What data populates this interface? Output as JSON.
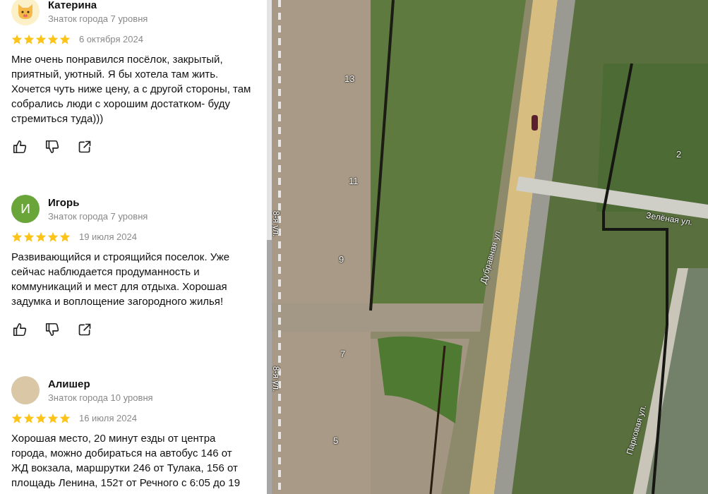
{
  "reviews": [
    {
      "author": "Катерина",
      "badge": "Знаток города 7 уровня",
      "avatar": {
        "kind": "emoji"
      },
      "stars": 5,
      "date": "6 октября 2024",
      "text": "Мне очень понравился посёлок, закрытый, приятный, уютный. Я бы хотела там жить. Хочется чуть ниже цену, а с другой стороны, там собрались люди с хорошим достатком- буду стремиться туда)))",
      "actions_shown": true
    },
    {
      "author": "Игорь",
      "badge": "Знаток города 7 уровня",
      "avatar": {
        "kind": "letter",
        "letter": "И",
        "color": "#6aa53a"
      },
      "stars": 5,
      "date": "19 июля 2024",
      "text": "Развивающийся и строящийся поселок. Уже сейчас наблюдается продуманность и коммуникаций и мест для отдыха. Хорошая задумка и воплощение загородного жилья!",
      "actions_shown": true
    },
    {
      "author": "Алишер",
      "badge": "Знаток города 10 уровня",
      "avatar": {
        "kind": "photo"
      },
      "stars": 5,
      "date": "16 июля 2024",
      "text": "Хорошая место, 20 минут езды от центра города, можно добираться на автобус 146 от ЖД вокзала, маршрутки 246 от Тулака, 156 от площадь Ленина, 152т от Речного с 6:05 до 19",
      "actions_shown": false
    }
  ],
  "map": {
    "labels": [
      {
        "kind": "house",
        "text": "13"
      },
      {
        "kind": "house",
        "text": "11"
      },
      {
        "kind": "house",
        "text": "9"
      },
      {
        "kind": "house",
        "text": "7"
      },
      {
        "kind": "house",
        "text": "5"
      },
      {
        "kind": "house",
        "text": "2"
      },
      {
        "kind": "street",
        "text": "Дубравная ул."
      },
      {
        "kind": "street",
        "text": "Зелёная ул."
      },
      {
        "kind": "street",
        "text": "Парковая ул."
      },
      {
        "kind": "street",
        "text": "8-я ул."
      },
      {
        "kind": "street",
        "text": "8-я ул."
      }
    ]
  }
}
